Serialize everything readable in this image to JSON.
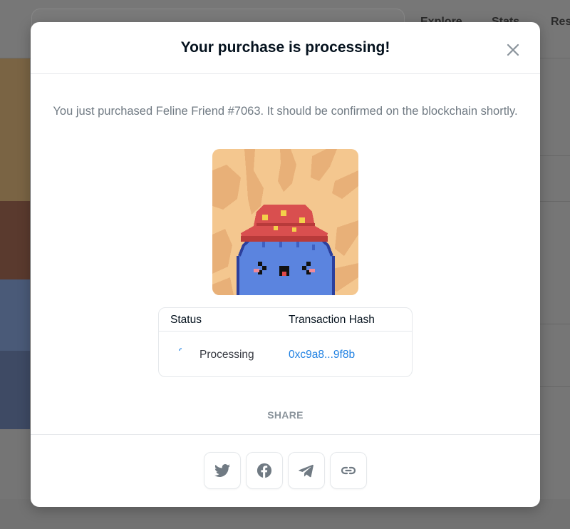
{
  "background": {
    "nav_items": [
      "Explore",
      "Stats",
      "Res"
    ]
  },
  "modal": {
    "title": "Your purchase is processing!",
    "message": "You just purchased Feline Friend #7063. It should be confirmed on the blockchain shortly.",
    "nft_image_icon": "pixel-cat-nft",
    "table": {
      "status_header": "Status",
      "hash_header": "Transaction Hash",
      "status_value": "Processing",
      "hash_value": "0xc9a8...9f8b"
    },
    "share_label": "SHARE",
    "share_buttons": [
      {
        "icon": "twitter-icon"
      },
      {
        "icon": "facebook-icon"
      },
      {
        "icon": "telegram-icon"
      },
      {
        "icon": "link-icon"
      }
    ]
  },
  "colors": {
    "accent_link": "#2081e2",
    "title_text": "#04111d",
    "muted_text": "#707a83",
    "icon_gray": "#707a83"
  }
}
